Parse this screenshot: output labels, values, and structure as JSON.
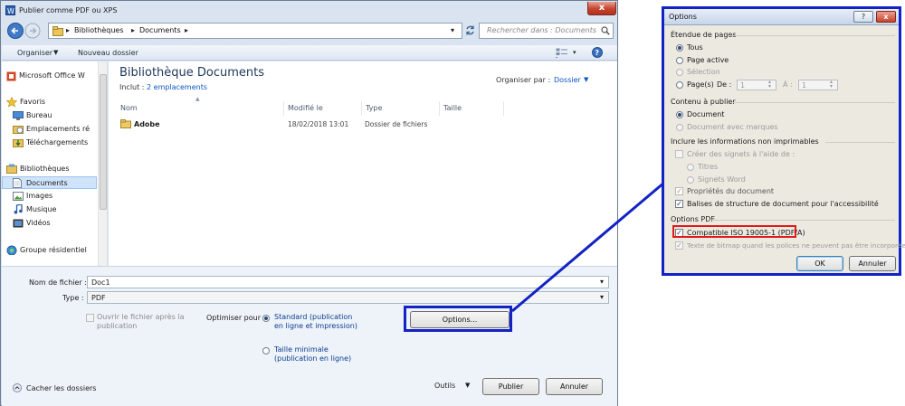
{
  "main_dialog": {
    "title": "Publier comme PDF ou XPS",
    "close_label": "x",
    "breadcrumb": [
      "Bibliothèques",
      "Documents"
    ],
    "search_placeholder": "Rechercher dans : Documents",
    "toolbar": {
      "organize": "Organiser",
      "new_folder": "Nouveau dossier"
    },
    "nav": {
      "items": [
        {
          "label": "Microsoft Office W",
          "icon": "office-icon"
        },
        {
          "label": "Favoris",
          "icon": "star-icon"
        },
        {
          "label": "Bureau",
          "icon": "desktop-icon"
        },
        {
          "label": "Emplacements ré",
          "icon": "recent-places-icon"
        },
        {
          "label": "Téléchargements",
          "icon": "downloads-icon"
        },
        {
          "label": "Bibliothèques",
          "icon": "libraries-icon"
        },
        {
          "label": "Documents",
          "icon": "documents-icon",
          "selected": true
        },
        {
          "label": "Images",
          "icon": "images-icon"
        },
        {
          "label": "Musique",
          "icon": "music-icon"
        },
        {
          "label": "Vidéos",
          "icon": "videos-icon"
        },
        {
          "label": "Groupe résidentiel",
          "icon": "homegroup-icon"
        }
      ]
    },
    "library": {
      "title": "Bibliothèque Documents",
      "includes_label": "Inclut :",
      "includes_link": "2 emplacements",
      "arrange_label": "Organiser par :",
      "arrange_value": "Dossier"
    },
    "columns": [
      "Nom",
      "Modifié le",
      "Type",
      "Taille"
    ],
    "files": [
      {
        "name": "Adobe",
        "modified": "18/02/2018 13:01",
        "type": "Dossier de fichiers",
        "size": ""
      }
    ],
    "filename_label": "Nom de fichier :",
    "filename_value": "Doc1",
    "type_label": "Type :",
    "type_value": "PDF",
    "open_after_label": "Ouvrir le fichier après la publication",
    "optimize_label": "Optimiser pour :",
    "optimize_standard": "Standard (publication en ligne et impression)",
    "optimize_minimal": "Taille minimale (publication en ligne)",
    "options_button": "Options...",
    "hide_folders": "Cacher les dossiers",
    "tools_label": "Outils",
    "publish_button": "Publier",
    "cancel_button": "Annuler"
  },
  "options_dialog": {
    "title": "Options",
    "help_label": "?",
    "close_label": "x",
    "page_range": {
      "heading": "Étendue de pages",
      "all": "Tous",
      "current": "Page active",
      "selection": "Sélection",
      "pages": "Page(s)",
      "from_label": "De :",
      "from_value": "1",
      "to_label": "À :",
      "to_value": "1"
    },
    "publish_what": {
      "heading": "Contenu à publier",
      "document": "Document",
      "document_markup": "Document avec marques"
    },
    "non_printing": {
      "heading": "Inclure les informations non imprimables",
      "create_bookmarks": "Créer des signets à l'aide de :",
      "headings": "Titres",
      "word_bookmarks": "Signets Word",
      "properties": "Propriétés du document",
      "structure_tags": "Balises de structure de document pour l'accessibilité"
    },
    "pdf_options": {
      "heading": "Options PDF",
      "iso": "Compatible ISO 19005-1 (PDF/A)",
      "bitmap_text": "Texte de bitmap quand les polices ne peuvent pas être incorporées"
    },
    "ok_button": "OK",
    "cancel_button": "Annuler"
  },
  "colors": {
    "highlight_blue": "#1222c4",
    "highlight_red": "#e01a1a",
    "link_blue": "#0b55c4"
  }
}
